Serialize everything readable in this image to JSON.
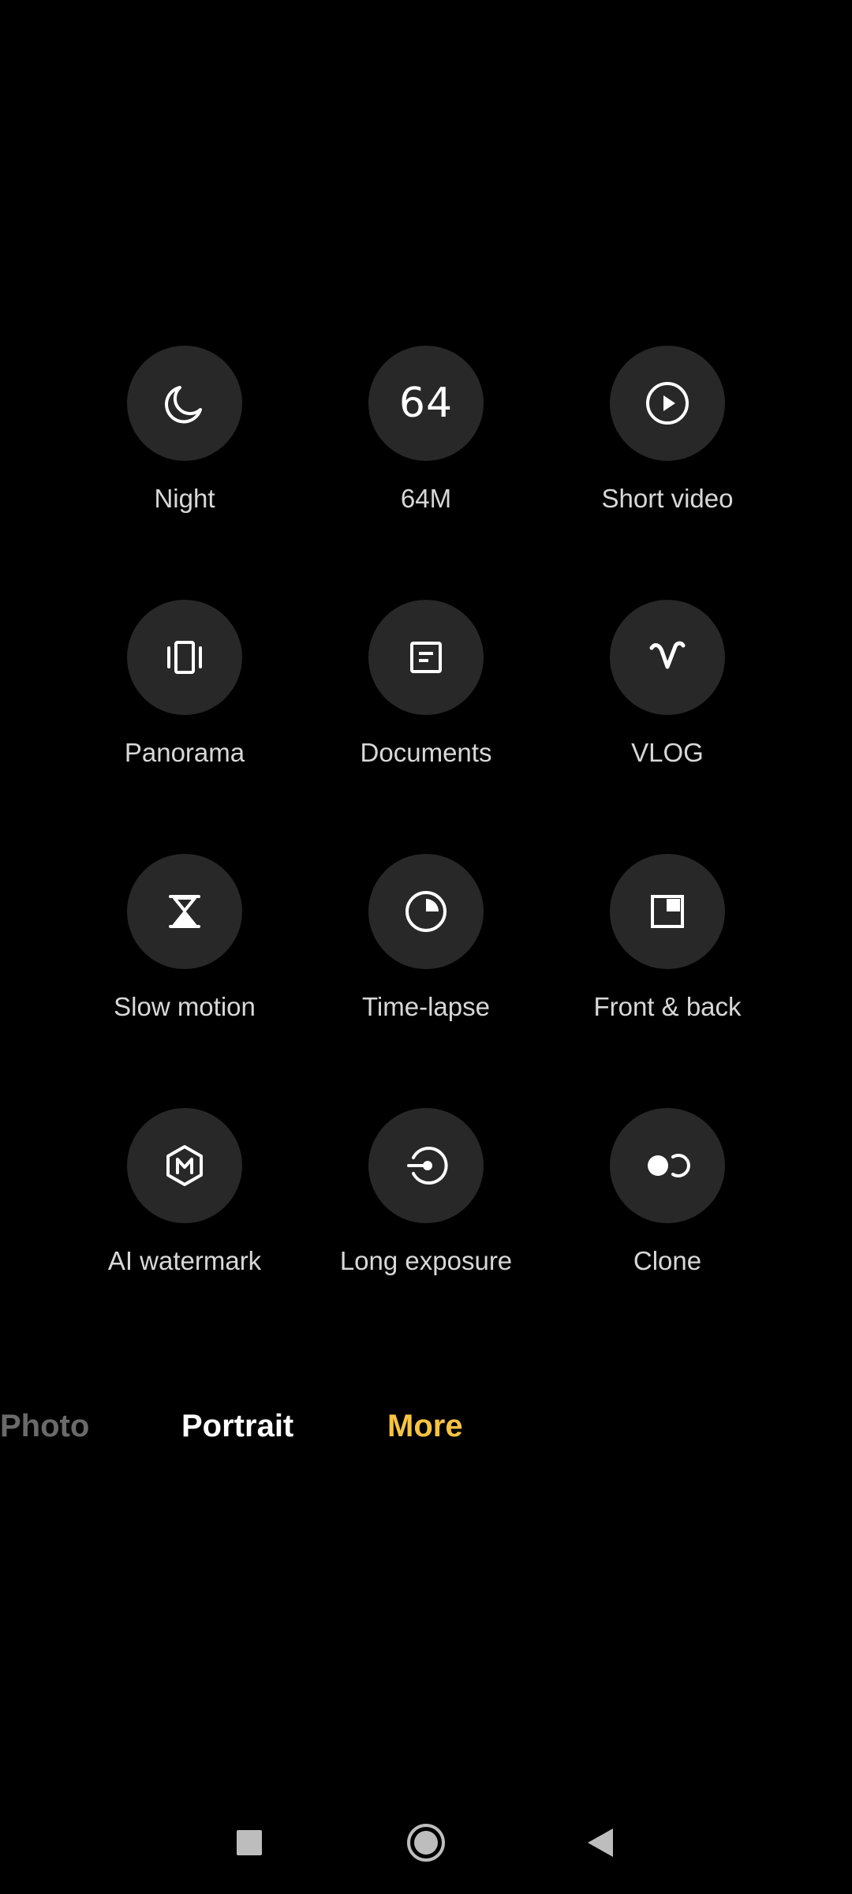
{
  "modes": [
    {
      "label": "Night",
      "icon": "moon-icon"
    },
    {
      "label": "64M",
      "icon": "64m-icon",
      "icon_text": "64"
    },
    {
      "label": "Short video",
      "icon": "play-circle-icon"
    },
    {
      "label": "Panorama",
      "icon": "panorama-icon"
    },
    {
      "label": "Documents",
      "icon": "document-icon"
    },
    {
      "label": "VLOG",
      "icon": "vlog-icon"
    },
    {
      "label": "Slow motion",
      "icon": "hourglass-icon"
    },
    {
      "label": "Time-lapse",
      "icon": "timelapse-icon"
    },
    {
      "label": "Front & back",
      "icon": "front-back-icon"
    },
    {
      "label": "AI watermark",
      "icon": "watermark-hexagon-icon"
    },
    {
      "label": "Long exposure",
      "icon": "long-exposure-icon"
    },
    {
      "label": "Clone",
      "icon": "clone-icon"
    }
  ],
  "mode_tabs": [
    {
      "label": "Photo",
      "state": "faded"
    },
    {
      "label": "Portrait",
      "state": "normal"
    },
    {
      "label": "More",
      "state": "selected"
    }
  ],
  "colors": {
    "background": "#000000",
    "tile": "#282828",
    "label": "#d8d8d8",
    "selected_tab": "#f6c343",
    "tab": "#ffffff"
  },
  "nav": {
    "recents": "square-icon",
    "home": "circle-icon",
    "back": "triangle-back-icon"
  }
}
